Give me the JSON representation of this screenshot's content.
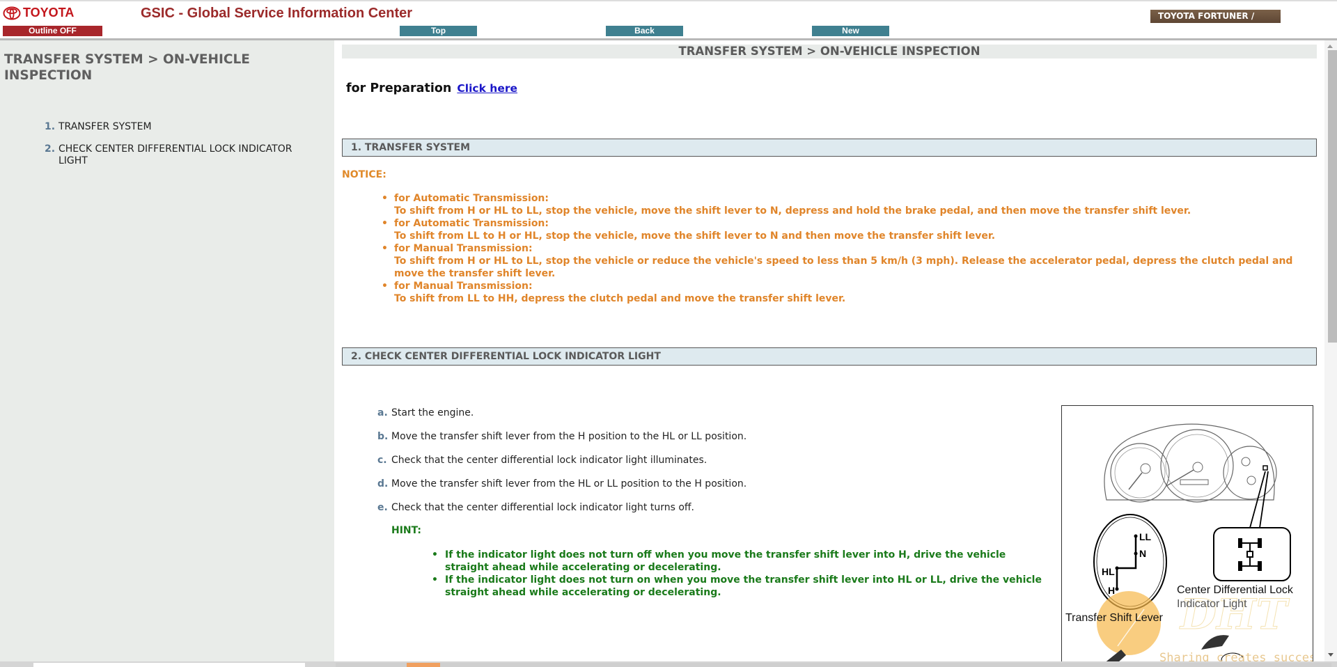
{
  "header": {
    "brand": "TOYOTA",
    "app_title": "GSIC - Global Service Information Center",
    "outline_button": "Outline OFF",
    "nav": {
      "top": "Top",
      "back": "Back",
      "new": "New"
    },
    "vehicle": "TOYOTA FORTUNER /"
  },
  "sidebar": {
    "title": "TRANSFER SYSTEM > ON-VEHICLE INSPECTION",
    "items": [
      {
        "num": "1.",
        "label": "TRANSFER SYSTEM"
      },
      {
        "num": "2.",
        "label": "CHECK CENTER DIFFERENTIAL LOCK INDICATOR LIGHT"
      }
    ]
  },
  "content": {
    "page_header": "TRANSFER SYSTEM > ON-VEHICLE INSPECTION",
    "preparation": {
      "label": "for Preparation",
      "link": "Click here"
    },
    "sections": [
      {
        "title": "1. TRANSFER SYSTEM"
      },
      {
        "title": "2. CHECK CENTER DIFFERENTIAL LOCK INDICATOR LIGHT"
      }
    ],
    "notice": {
      "label": "NOTICE:",
      "items": [
        {
          "heading": "for Automatic Transmission:",
          "text": "To shift from H or HL to LL, stop the vehicle, move the shift lever to N, depress and hold the brake pedal, and then move the transfer shift lever."
        },
        {
          "heading": "for Automatic Transmission:",
          "text": "To shift from LL to H or HL, stop the vehicle, move the shift lever to N and then move the transfer shift lever."
        },
        {
          "heading": "for Manual Transmission:",
          "text": "To shift from H or HL to LL, stop the vehicle or reduce the vehicle's speed to less than 5 km/h (3 mph). Release the accelerator pedal, depress the clutch pedal and move the transfer shift lever."
        },
        {
          "heading": "for Manual Transmission:",
          "text": "To shift from LL to HH, depress the clutch pedal and move the transfer shift lever."
        }
      ]
    },
    "steps": [
      {
        "letter": "a.",
        "text": "Start the engine."
      },
      {
        "letter": "b.",
        "text": "Move the transfer shift lever from the H position to the HL or LL position."
      },
      {
        "letter": "c.",
        "text": "Check that the center differential lock indicator light illuminates."
      },
      {
        "letter": "d.",
        "text": "Move the transfer shift lever from the HL or LL position to the H position."
      },
      {
        "letter": "e.",
        "text": "Check that the center differential lock indicator light turns off."
      }
    ],
    "hint": {
      "label": "HINT:",
      "items": [
        "If the indicator light does not turn off when you move the transfer shift lever into H, drive the vehicle straight ahead while accelerating or decelerating.",
        "If the indicator light does not turn on when you move the transfer shift lever into HL or LL, drive the vehicle straight ahead while accelerating or decelerating."
      ]
    },
    "figure": {
      "shift_positions": [
        "LL",
        "N",
        "HL",
        "H"
      ],
      "label_indicator": "Center Differential Lock",
      "label_indicator_2": "Indicator Light",
      "label_lever": "Transfer Shift Lever",
      "watermark_logo": "DHT",
      "watermark_text": "Sharing creates success"
    }
  }
}
